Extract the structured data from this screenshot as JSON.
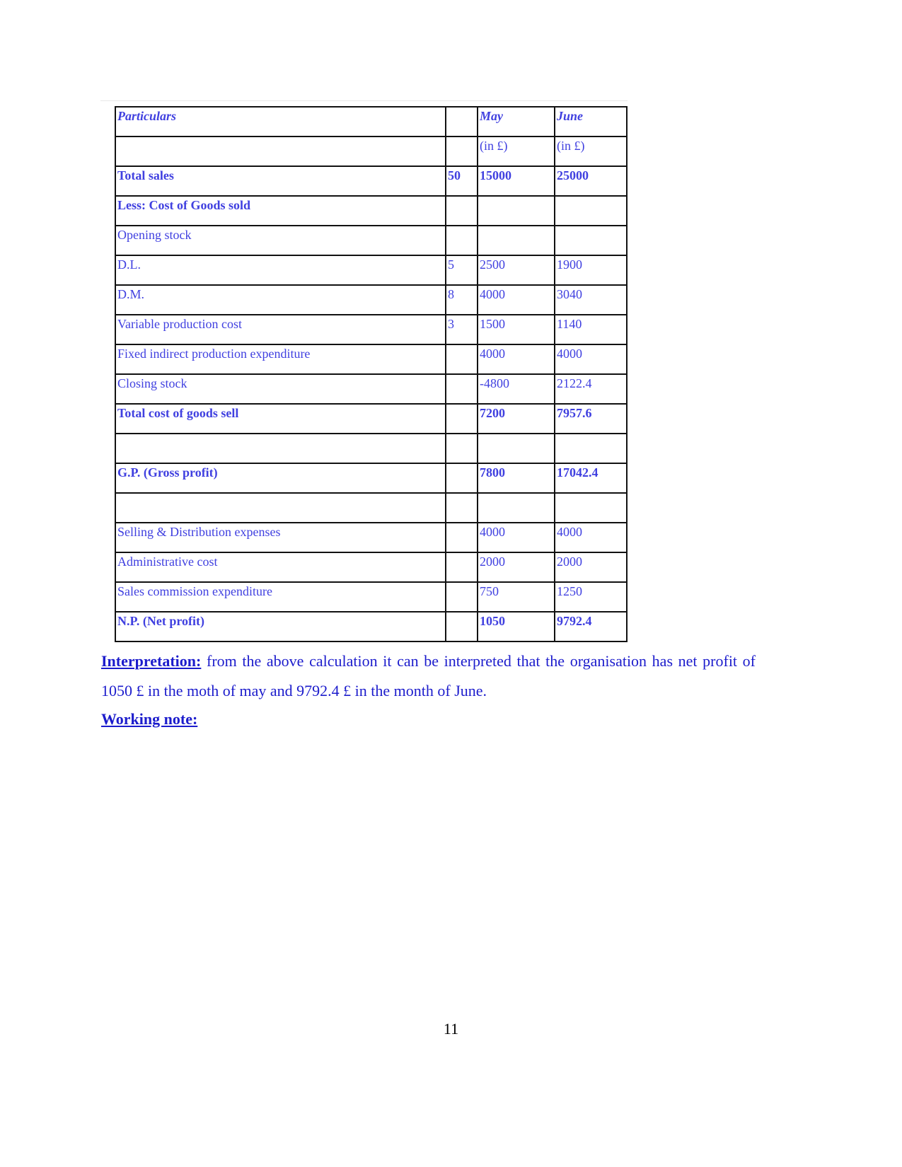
{
  "table": {
    "header": {
      "particulars": "Particulars",
      "rate": "",
      "may": "May",
      "june": "June"
    },
    "rows": [
      {
        "label": "",
        "rate": "",
        "may": "(in £)",
        "june": "(in £)",
        "bold": false
      },
      {
        "label": "Total sales",
        "rate": "50",
        "may": "15000",
        "june": "25000",
        "bold": true
      },
      {
        "label": "Less: Cost of Goods sold",
        "rate": "",
        "may": "",
        "june": "",
        "bold": true
      },
      {
        "label": "Opening stock",
        "rate": "",
        "may": "",
        "june": "",
        "bold": false
      },
      {
        "label": "D.L.",
        "rate": "5",
        "may": "2500",
        "june": "1900",
        "bold": false
      },
      {
        "label": "D.M.",
        "rate": "8",
        "may": "4000",
        "june": "3040",
        "bold": false
      },
      {
        "label": "Variable production cost",
        "rate": "3",
        "may": "1500",
        "june": "1140",
        "bold": false
      },
      {
        "label": "Fixed indirect production expenditure",
        "rate": "",
        "may": "4000",
        "june": "4000",
        "bold": false
      },
      {
        "label": "Closing stock",
        "rate": "",
        "may": "-4800",
        "june": "2122.4",
        "bold": false
      },
      {
        "label": "Total cost of goods sell",
        "rate": "",
        "may": "7200",
        "june": "7957.6",
        "bold": true
      },
      {
        "label": "",
        "rate": "",
        "may": "",
        "june": "",
        "bold": false
      },
      {
        "label": "G.P. (Gross profit)",
        "rate": "",
        "may": "7800",
        "june": "17042.4",
        "bold": true
      },
      {
        "label": "",
        "rate": "",
        "may": "",
        "june": "",
        "bold": false
      },
      {
        "label": "Selling & Distribution expenses",
        "rate": "",
        "may": "4000",
        "june": "4000",
        "bold": false
      },
      {
        "label": "Administrative cost",
        "rate": "",
        "may": "2000",
        "june": "2000",
        "bold": false
      },
      {
        "label": "Sales commission expenditure",
        "rate": "",
        "may": "750",
        "june": "1250",
        "bold": false
      },
      {
        "label": "N.P. (Net profit)",
        "rate": "",
        "may": "1050",
        "june": "9792.4",
        "bold": true
      }
    ]
  },
  "interpretation": {
    "label": "Interpretation:",
    "text": " from the above calculation it can be interpreted that the organisation has net profit of 1050  £ in the moth of may and 9792.4  £ in the month of June."
  },
  "working_note": {
    "label": "Working note:"
  },
  "page_number": "11",
  "colors": {
    "table_text": "#4040e0",
    "body_text": "#1c1ccc"
  }
}
